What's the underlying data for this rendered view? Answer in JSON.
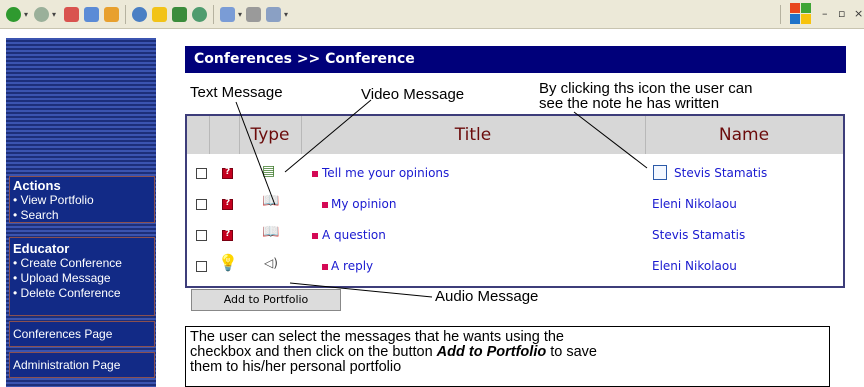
{
  "breadcrumb": "Conferences >> Conference",
  "sidebar": {
    "actions": {
      "title": "Actions",
      "items": [
        "• View Portfolio",
        "• Search"
      ]
    },
    "educator": {
      "title": "Educator",
      "items": [
        "• Create Conference",
        "• Upload Message",
        "• Delete Conference"
      ]
    },
    "links": [
      "Conferences Page",
      "Administration Page"
    ]
  },
  "table": {
    "headers": [
      "Type",
      "Title",
      "Name"
    ],
    "rows": [
      {
        "title": "Tell me your opinions",
        "name": "Stevis Stamatis",
        "type": "video-message-icon",
        "has_note": true
      },
      {
        "title": "My opinion",
        "name": "Eleni Nikolaou",
        "type": "text-message-icon",
        "has_note": false
      },
      {
        "title": "A question",
        "name": "Stevis Stamatis",
        "type": "text-message-icon",
        "has_note": false
      },
      {
        "title": "A reply",
        "name": "Eleni Nikolaou",
        "type": "audio-message-icon",
        "has_note": false
      }
    ]
  },
  "add_button": "Add to  Portfolio",
  "annotations": {
    "text_message": "Text Message",
    "video_message": "Video Message",
    "note_hint_line1": "By clicking ths icon the user can",
    "note_hint_line2": "see the note he has written",
    "audio_message": "Audio Message"
  },
  "explanation": {
    "line1": "The user can select the messages that he wants using the",
    "line2_pre": "checkbox and then click on the button ",
    "line2_bold": "Add to Portfolio",
    "line2_post": " to save",
    "line3": "them to his/her personal portfolio"
  },
  "colors": {
    "header_bg": "#00007a",
    "sidebar_bg": "#122a86",
    "link": "#1a1ad0",
    "header_text": "#6b0b0b"
  }
}
